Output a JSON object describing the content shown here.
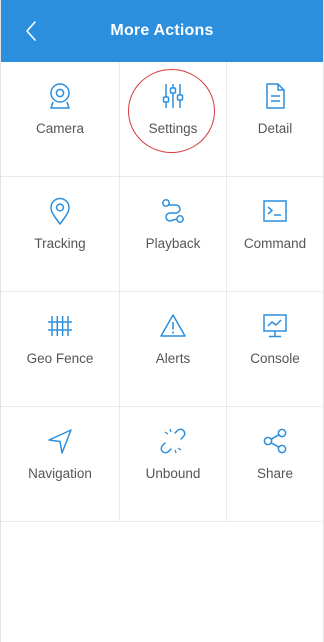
{
  "header": {
    "title": "More Actions",
    "back_icon": "chevron-left-icon"
  },
  "colors": {
    "header_bg": "#2c8fde",
    "icon": "#2c8fde",
    "label": "#555555",
    "highlight": "#d83b3b"
  },
  "actions": [
    {
      "label": "Camera",
      "icon": "camera-icon"
    },
    {
      "label": "Settings",
      "icon": "sliders-icon",
      "highlighted": true
    },
    {
      "label": "Detail",
      "icon": "document-icon"
    },
    {
      "label": "Tracking",
      "icon": "location-pin-icon"
    },
    {
      "label": "Playback",
      "icon": "route-icon"
    },
    {
      "label": "Command",
      "icon": "terminal-icon"
    },
    {
      "label": "Geo Fence",
      "icon": "fence-icon"
    },
    {
      "label": "Alerts",
      "icon": "warning-icon"
    },
    {
      "label": "Console",
      "icon": "monitor-chart-icon"
    },
    {
      "label": "Navigation",
      "icon": "navigation-arrow-icon"
    },
    {
      "label": "Unbound",
      "icon": "broken-link-icon"
    },
    {
      "label": "Share",
      "icon": "share-icon"
    }
  ]
}
